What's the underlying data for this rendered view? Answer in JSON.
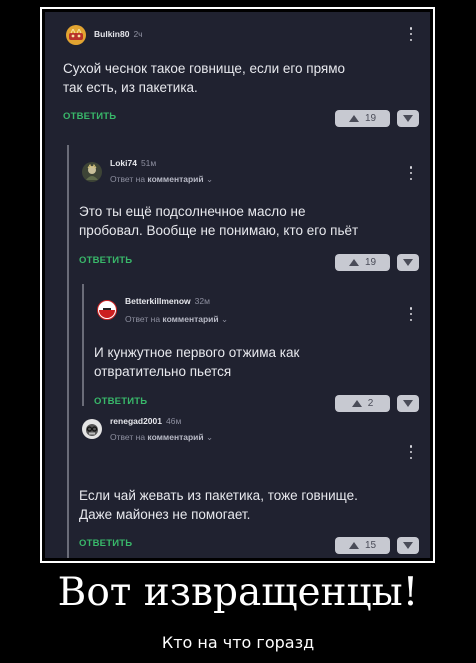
{
  "comments": [
    {
      "username": "Bulkin80",
      "time": "2ч",
      "avatar_icon": "chinese-zodiac-avatar",
      "reply_to": "",
      "text": [
        "Сухой чеснок такое говнище, если его прямо",
        "так есть, из пакетика."
      ],
      "reply_label": "ОТВЕТИТЬ",
      "votes": "19"
    },
    {
      "username": "Loki74",
      "time": "51м",
      "avatar_icon": "character-avatar",
      "reply_to_prefix": "Ответ на",
      "reply_to": "комментарий",
      "text": [
        "Это ты ещё подсолнечное масло не",
        "пробовал. Вообще не понимаю, кто его пьёт"
      ],
      "reply_label": "ОТВЕТИТЬ",
      "votes": "19"
    },
    {
      "username": "Betterkillmenow",
      "time": "32м",
      "avatar_icon": "keep-calm-avatar",
      "reply_to_prefix": "Ответ на",
      "reply_to": "комментарий",
      "text": [
        "И кунжутное первого отжима как",
        "отвратительно пьется"
      ],
      "reply_label": "ОТВЕТИТЬ",
      "votes": "2"
    },
    {
      "username": "renegad2001",
      "time": "46м",
      "avatar_icon": "gorilla-glasses-avatar",
      "reply_to_prefix": "Ответ на",
      "reply_to": "комментарий",
      "text": [
        "Если чай жевать из пакетика, тоже говнище.",
        "Даже майонез не помогает."
      ],
      "reply_label": "ОТВЕТИТЬ",
      "votes": "15"
    }
  ],
  "caption": {
    "title": "Вот извращенцы!",
    "subtitle": "Кто на что горазд"
  },
  "colors": {
    "panel_bg": "#202230",
    "reply_green": "#39b86a",
    "vote_bg": "#c7c9d1",
    "text": "#e8e9ee",
    "muted": "#8e90a0"
  }
}
